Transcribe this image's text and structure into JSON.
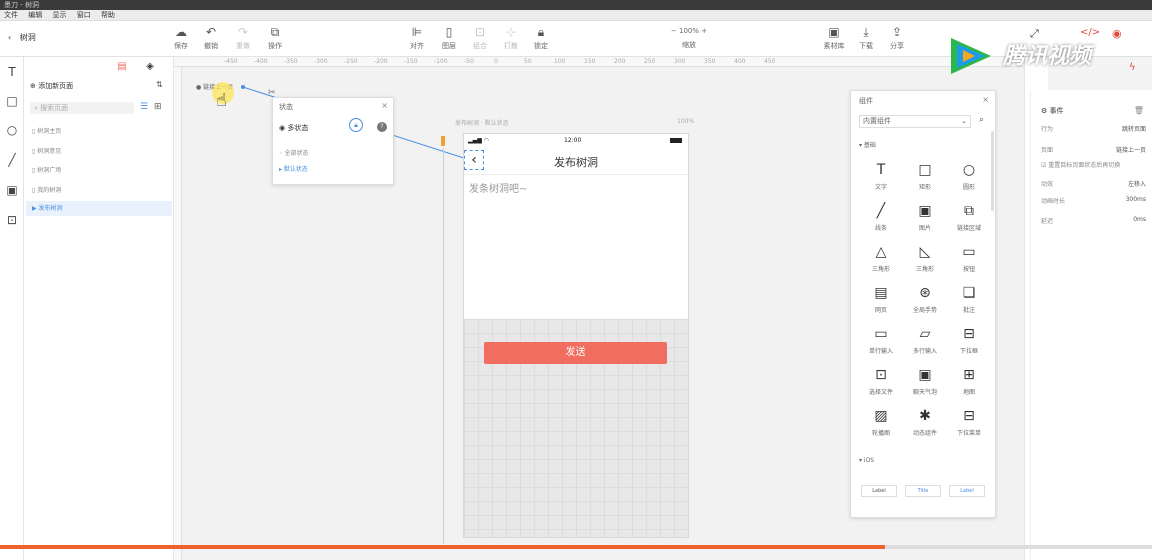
{
  "titlebar": {
    "title": "墨刀 - 树洞"
  },
  "menubar": {
    "items": [
      "文件",
      "编辑",
      "显示",
      "窗口",
      "帮助"
    ]
  },
  "toolbar": {
    "back_label": "树洞",
    "save": "保存",
    "undo": "撤销",
    "redo": "重做",
    "ops": "操作",
    "align": "对齐",
    "layer": "图层",
    "group": "组合",
    "ungroup": "打散",
    "lock": "锁定",
    "zoom_value": "100%",
    "zoom_label": "缩放",
    "assets": "素材库",
    "download": "下载",
    "share": "分享"
  },
  "pages": {
    "add_label": "添加新页面",
    "search_placeholder": "搜索页面",
    "items": [
      "树洞主页",
      "树洞意见",
      "树洞广场",
      "我的树洞",
      "发布树洞"
    ]
  },
  "canvas": {
    "ruler_ticks": [
      "-450",
      "-400",
      "-350",
      "-300",
      "-250",
      "-200",
      "-150",
      "-100",
      "-50",
      "0",
      "50",
      "100",
      "150",
      "200",
      "250",
      "300",
      "350",
      "400",
      "450"
    ],
    "link_label": "链接上一页",
    "artboard_label": "发布树洞 · 默认状态",
    "artboard_zoom": "100%"
  },
  "state_panel": {
    "title": "状态",
    "multi_state": "多状态",
    "all_states": "全部状态",
    "default_state": "默认状态"
  },
  "phone": {
    "time": "12:00",
    "header_title": "发布树洞",
    "placeholder": "发条树洞吧~",
    "send_button": "发送"
  },
  "components": {
    "title": "组件",
    "select_value": "内置组件",
    "section_basic": "基础",
    "section_ios": "iOS",
    "items": [
      "文字",
      "矩形",
      "圆形",
      "线条",
      "图片",
      "链接区域",
      "三角形",
      "三角形",
      "按钮",
      "网页",
      "全局手势",
      "批注",
      "单行输入",
      "多行输入",
      "下拉框",
      "选择文件",
      "聊天气泡",
      "地图",
      "轮播图",
      "动态组件",
      "下拉菜单"
    ],
    "icons": [
      "T",
      "□",
      "○",
      "╱",
      "▣",
      "⧉",
      "△",
      "◺",
      "▭",
      "▤",
      "⊛",
      "❏",
      "▭",
      "▱",
      "⊟",
      "⊡",
      "▣",
      "⊞",
      "▨",
      "✱",
      "⊟"
    ],
    "ios_items": [
      "Label",
      "Title",
      "Label"
    ]
  },
  "props": {
    "header": "事件",
    "rows": [
      {
        "label": "行为",
        "value": "跳转页面"
      },
      {
        "label": "页面",
        "value": "链接上一页"
      },
      {
        "label": "",
        "value": "重置目标页面状态后再切换"
      },
      {
        "label": "动效",
        "value": "左移入"
      },
      {
        "label": "动画时长",
        "value": "300ms"
      },
      {
        "label": "延迟",
        "value": "0ms"
      }
    ]
  },
  "video": {
    "watermark": "腾讯视频",
    "progress_pct": 77
  },
  "colors": {
    "accent": "#f06d5f",
    "progress": "#f0622d",
    "link_line": "#4a8fe0"
  }
}
